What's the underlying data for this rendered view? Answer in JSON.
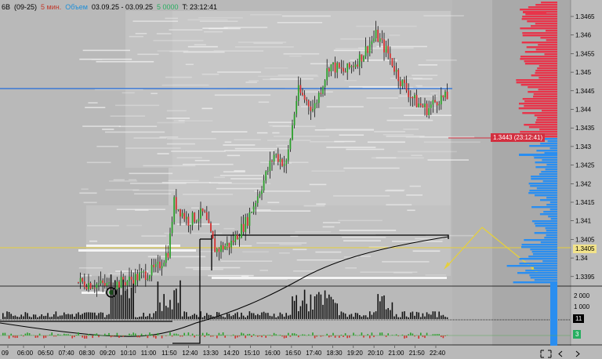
{
  "header": {
    "symbol": "6B",
    "contract": "(09-25)",
    "timeframe": "5 мин.",
    "mode": "Объем",
    "date_range": "03.09.25 - 03.09.25",
    "volume": "5 0000",
    "time": "T: 23:12:41",
    "colors": {
      "timeframe": "#c0392b",
      "mode": "#1f8fd8",
      "volume": "#27ae60"
    }
  },
  "price_axis": {
    "labels": [
      "1.3465",
      "1.346",
      "1.3455",
      "1.345",
      "1.3445",
      "1.344",
      "1.3435",
      "1.343",
      "1.3425",
      "1.342",
      "1.3415",
      "1.341",
      "1.3405",
      "1.34",
      "1.3395"
    ]
  },
  "current_price_tag": "1.3443 (23:12:41)",
  "level_tag": "1.3405",
  "volume_axis": {
    "label_2000": "2 000",
    "label_1000": "1 000"
  },
  "indicator_tags": {
    "upper": "11",
    "lower": "3"
  },
  "time_axis": {
    "labels": [
      "09",
      "06:00",
      "06:50",
      "07:40",
      "08:30",
      "09:20",
      "10:10",
      "11:00",
      "11:50",
      "12:40",
      "13:30",
      "14:20",
      "15:10",
      "16:00",
      "16:50",
      "17:40",
      "18:30",
      "19:20",
      "20:10",
      "21:00",
      "21:50",
      "22:40"
    ]
  },
  "colors": {
    "background": "#b9b9b9",
    "bid_profile": "#e8344a",
    "ask_profile": "#2a8ef0",
    "blue_level": "#3a78d6",
    "yellow_level": "#e6d03a",
    "up_candle": "#2ca02c",
    "down_candle": "#d32f2f",
    "wick": "#111111"
  },
  "icons": [
    "fullscreen-icon",
    "arrow-left-icon",
    "arrow-right-icon"
  ]
}
